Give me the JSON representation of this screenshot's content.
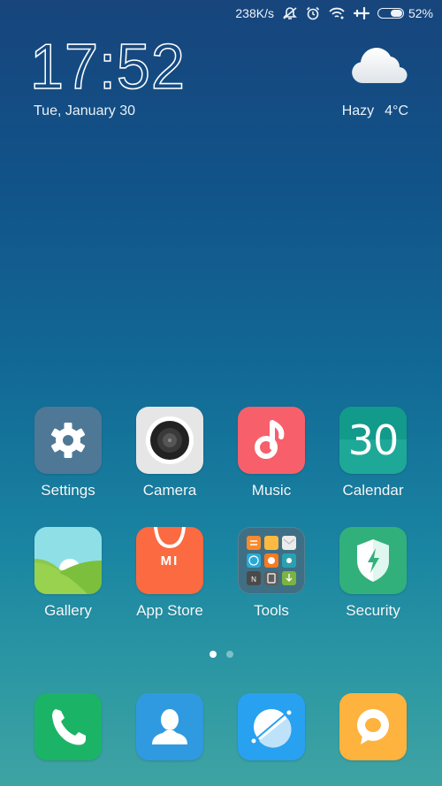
{
  "status_bar": {
    "network_speed": "238K/s",
    "icons": [
      "notifications-muted-icon",
      "alarm-icon",
      "wifi-icon",
      "airplane-mode-icon",
      "battery-icon"
    ],
    "battery_percent": "52%",
    "battery_level": 0.52
  },
  "clock_widget": {
    "time": "17:52",
    "date": "Tue, January 30"
  },
  "weather_widget": {
    "icon": "cloud-icon",
    "condition": "Hazy",
    "temperature": "4°C"
  },
  "home_apps": [
    {
      "label": "Settings",
      "icon": "gear-icon",
      "color": "#4f7896"
    },
    {
      "label": "Camera",
      "icon": "camera-lens-icon",
      "color": "#e6e6e6"
    },
    {
      "label": "Music",
      "icon": "music-note-icon",
      "color": "#f7606a"
    },
    {
      "label": "Calendar",
      "icon": "calendar-icon",
      "color": "#1ea898",
      "day": "30"
    },
    {
      "label": "Gallery",
      "icon": "landscape-icon",
      "color": "#8fe0e6"
    },
    {
      "label": "App Store",
      "icon": "shopping-bag-icon",
      "color": "#fb6a40",
      "brand": "MI"
    },
    {
      "label": "Tools",
      "icon": "folder-icon",
      "color": "#3f6f84"
    },
    {
      "label": "Security",
      "icon": "shield-icon",
      "color": "#31b07b"
    }
  ],
  "page_indicator": {
    "pages": 2,
    "current": 1
  },
  "dock": [
    {
      "name": "Phone",
      "icon": "phone-icon",
      "color": "#1bb466"
    },
    {
      "name": "Contacts",
      "icon": "contact-person-icon",
      "color": "#2f9ae0"
    },
    {
      "name": "Browser",
      "icon": "browser-planet-icon",
      "color": "#27a1f0"
    },
    {
      "name": "Messaging",
      "icon": "chat-bubble-icon",
      "color": "#fdb33e"
    }
  ]
}
